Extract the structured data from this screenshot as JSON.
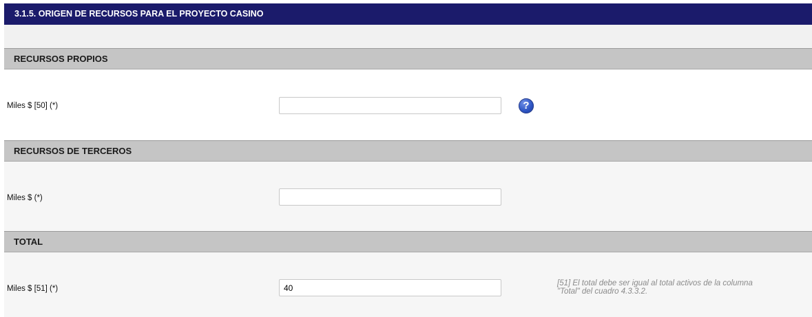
{
  "title": "3.1.5. ORIGEN DE RECURSOS PARA EL PROYECTO CASINO",
  "sections": {
    "propios": {
      "header": "RECURSOS PROPIOS",
      "field_label": "Miles $ [50] (*)",
      "field_value": ""
    },
    "terceros": {
      "header": "RECURSOS DE TERCEROS",
      "field_label": "Miles $ (*)",
      "field_value": ""
    },
    "total": {
      "header": "TOTAL",
      "field_label": "Miles $ [51] (*)",
      "field_value": "40",
      "note_line1": "[51] El total debe ser igual al total activos de la columna",
      "note_line2": "\"Total\" del cuadro 4.3.3.2."
    }
  },
  "colors": {
    "title_bar": "#1b1b6b",
    "section_header": "#c5c5c5",
    "help_icon": "#2e55c4"
  },
  "icons": {
    "help": "question-mark-icon"
  }
}
